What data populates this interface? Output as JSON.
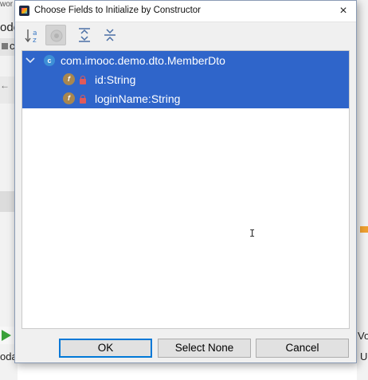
{
  "dialog": {
    "title": "Choose Fields to Initialize by Constructor",
    "close_glyph": "×"
  },
  "toolbar": {
    "buttons": [
      {
        "name": "sort-alphabetically",
        "icon": "sort-az-icon"
      },
      {
        "name": "show-classes",
        "icon": "class-circle-icon",
        "pressed": true
      },
      {
        "name": "expand-all",
        "icon": "expand-all-icon"
      },
      {
        "name": "collapse-all",
        "icon": "collapse-all-icon"
      }
    ],
    "sort_letters": {
      "top": "a",
      "bottom": "z"
    }
  },
  "tree": {
    "class_node": {
      "icon_letter": "c",
      "label": "com.imooc.demo.dto.MemberDto",
      "expanded": true,
      "selected": true
    },
    "fields": [
      {
        "icon_letter": "f",
        "label": "id:String",
        "selected": true
      },
      {
        "icon_letter": "f",
        "label": "loginName:String",
        "selected": true
      }
    ]
  },
  "buttons": {
    "ok": "OK",
    "select_none": "Select None",
    "cancel": "Cancel"
  },
  "colors": {
    "selection": "#2f65ca",
    "default_button_border": "#0078d7",
    "field_icon": "#a8874f",
    "class_icon": "#3d8fd6"
  },
  "background": {
    "fragments": [
      "wor",
      "ode",
      "c",
      "Vo",
      "U",
      "oda"
    ]
  }
}
